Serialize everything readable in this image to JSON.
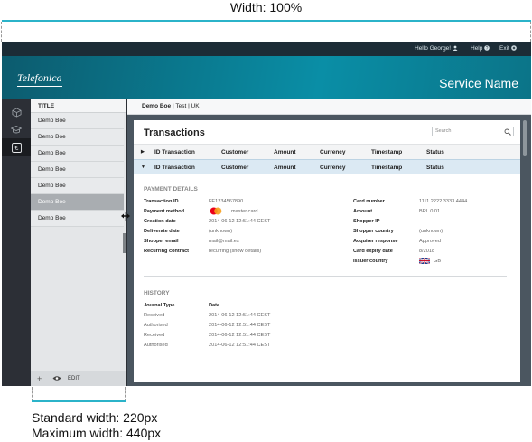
{
  "annotations": {
    "width_label": "Width: 100%",
    "standard_width": "Standard width: 220px",
    "maximum_width": "Maximum width: 440px"
  },
  "topbar": {
    "greeting": "Hello George!",
    "help": "Help",
    "exit": "Exit"
  },
  "header": {
    "logo": "Telefonica",
    "service_name": "Service Name"
  },
  "rail": {
    "icons": [
      "cube-icon",
      "graduation-cap-icon",
      "euro-icon"
    ],
    "active_index": 2
  },
  "sidebar": {
    "title": "TITLE",
    "items": [
      "Demo Boe",
      "Demo Boe",
      "Demo Boe",
      "Demo Boe",
      "Demo Boe",
      "Demo Boe",
      "Demo Boe"
    ],
    "selected_index": 5,
    "footer": {
      "add": "+",
      "edit": "EDIT"
    }
  },
  "breadcrumb": {
    "strong": "Demo Boe",
    "rest": " | Test | UK"
  },
  "panel": {
    "title": "Transactions",
    "search_placeholder": "Search",
    "columns": [
      "ID Transaction",
      "Customer",
      "Amount",
      "Currency",
      "Timestamp",
      "Status"
    ]
  },
  "payment_details": {
    "title": "PAYMENT DETAILS",
    "left": [
      {
        "label": "Transaction ID",
        "value": "FE1234567890"
      },
      {
        "label": "Payment method",
        "value": "master card"
      },
      {
        "label": "Creation date",
        "value": "2014-06-12  12:51:44 CEST"
      },
      {
        "label": "Deliverate date",
        "value": "(unknown)"
      },
      {
        "label": "Shopper email",
        "value": "mail@mail.es"
      },
      {
        "label": "Recurring contract",
        "value": "recurring (show details)"
      }
    ],
    "right": [
      {
        "label": "Card number",
        "value": "1111 2222 3333 4444"
      },
      {
        "label": "Amount",
        "value": "BRL 0.01"
      },
      {
        "label": "Shopper IP",
        "value": ""
      },
      {
        "label": "Shopper country",
        "value": "(unknown)"
      },
      {
        "label": "Acquirer response",
        "value": "Approved"
      },
      {
        "label": "Card expiry date",
        "value": "8/2018"
      },
      {
        "label": "Issuer country",
        "value": "GB"
      }
    ]
  },
  "history": {
    "title": "HISTORY",
    "columns": [
      "Journal Type",
      "Date"
    ],
    "rows": [
      [
        "Received",
        "2014-06-12 12:51:44 CEST"
      ],
      [
        "Authorised",
        "2014-06-12 12:51:44 CEST"
      ],
      [
        "Received",
        "2014-06-12 12:51:44 CEST"
      ],
      [
        "Authorised",
        "2014-06-12 12:51:44 CEST"
      ]
    ]
  },
  "colors": {
    "accent": "#2bb3c9",
    "banner": "#0a7d93",
    "topbar": "#1c2c36",
    "selected_row": "#dbe9f3",
    "mastercard_red": "#eb001b",
    "mastercard_orange": "#f79e1b"
  }
}
